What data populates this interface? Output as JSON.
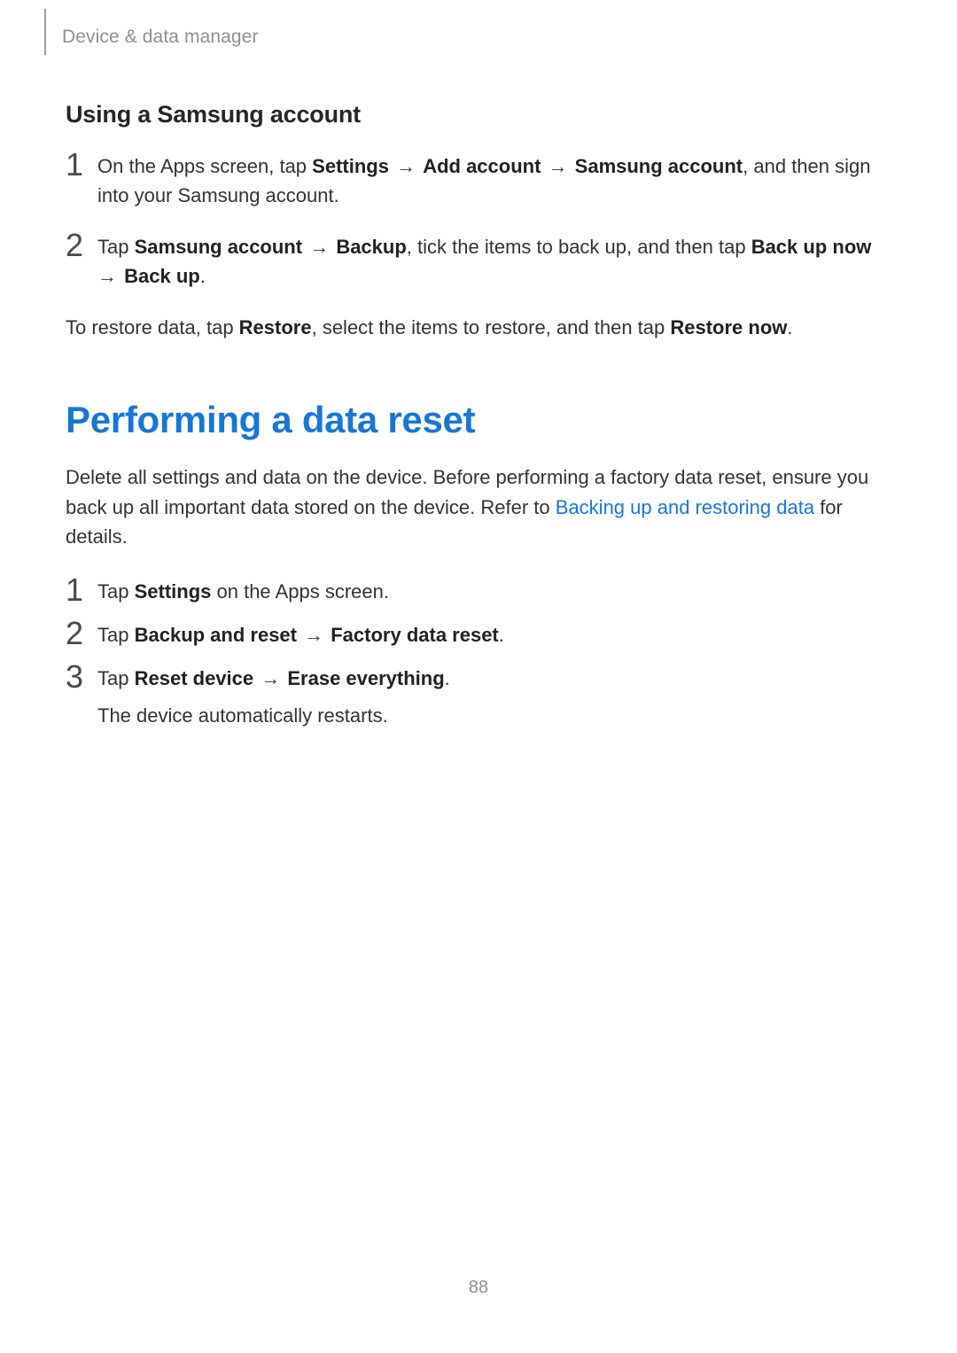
{
  "breadcrumb": "Device & data manager",
  "section1": {
    "heading": "Using a Samsung account",
    "steps": [
      {
        "n": "1",
        "parts": [
          {
            "t": "On the Apps screen, tap "
          },
          {
            "t": "Settings",
            "b": true
          },
          {
            "t": " → ",
            "arrow": true
          },
          {
            "t": "Add account",
            "b": true
          },
          {
            "t": " → ",
            "arrow": true
          },
          {
            "t": "Samsung account",
            "b": true
          },
          {
            "t": ", and then sign into your Samsung account."
          }
        ]
      },
      {
        "n": "2",
        "parts": [
          {
            "t": "Tap "
          },
          {
            "t": "Samsung account",
            "b": true
          },
          {
            "t": " → ",
            "arrow": true
          },
          {
            "t": "Backup",
            "b": true
          },
          {
            "t": ", tick the items to back up, and then tap "
          },
          {
            "t": "Back up now",
            "b": true
          },
          {
            "t": " → ",
            "arrow": true
          },
          {
            "t": "Back up",
            "b": true
          },
          {
            "t": "."
          }
        ]
      }
    ],
    "afterParts": [
      {
        "t": "To restore data, tap "
      },
      {
        "t": "Restore",
        "b": true
      },
      {
        "t": ", select the items to restore, and then tap "
      },
      {
        "t": "Restore now",
        "b": true
      },
      {
        "t": "."
      }
    ]
  },
  "section2": {
    "heading": "Performing a data reset",
    "introParts": [
      {
        "t": "Delete all settings and data on the device. Before performing a factory data reset, ensure you back up all important data stored on the device. Refer to "
      },
      {
        "t": "Backing up and restoring data",
        "link": true
      },
      {
        "t": " for details."
      }
    ],
    "steps": [
      {
        "n": "1",
        "parts": [
          {
            "t": "Tap "
          },
          {
            "t": "Settings",
            "b": true
          },
          {
            "t": " on the Apps screen."
          }
        ]
      },
      {
        "n": "2",
        "parts": [
          {
            "t": "Tap "
          },
          {
            "t": "Backup and reset",
            "b": true
          },
          {
            "t": " → ",
            "arrow": true
          },
          {
            "t": "Factory data reset",
            "b": true
          },
          {
            "t": "."
          }
        ]
      },
      {
        "n": "3",
        "parts": [
          {
            "t": "Tap "
          },
          {
            "t": "Reset device",
            "b": true
          },
          {
            "t": " → ",
            "arrow": true
          },
          {
            "t": "Erase everything",
            "b": true
          },
          {
            "t": "."
          }
        ],
        "sub": "The device automatically restarts."
      }
    ]
  },
  "pageNumber": "88"
}
